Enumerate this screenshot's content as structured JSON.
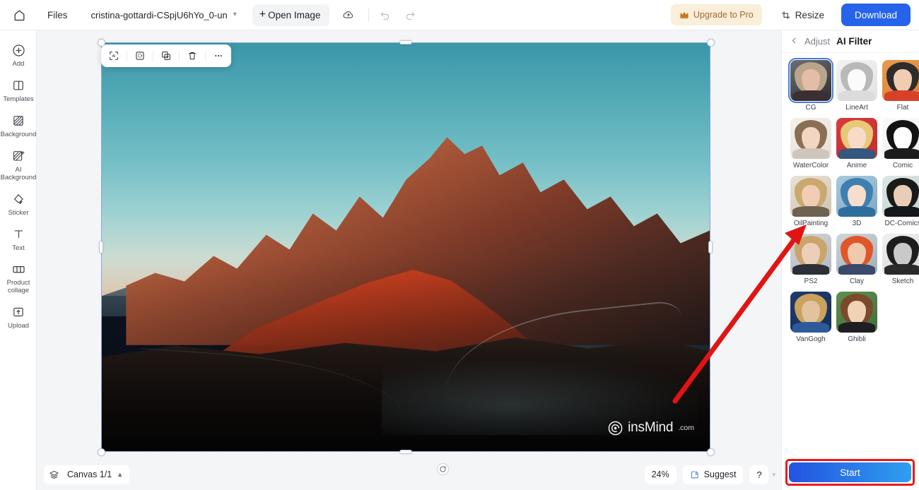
{
  "topbar": {
    "home_icon": "home-icon",
    "files_label": "Files",
    "filename": "cristina-gottardi-CSpjU6hYo_0-un",
    "filename_chevron": "chevron-down-icon",
    "open_image_label": "Open Image",
    "open_image_plus": "+",
    "cloud_icon": "cloud-sync-icon",
    "undo_icon": "undo-icon",
    "redo_icon": "redo-icon",
    "upgrade_label": "Upgrade to Pro",
    "upgrade_icon": "crown-icon",
    "upgrade_bg": "#fbeeda",
    "upgrade_fg": "#a06a2c",
    "resize_label": "Resize",
    "resize_icon": "resize-icon",
    "download_label": "Download",
    "download_bg": "#2563eb"
  },
  "sidebar": {
    "items": [
      {
        "label": "Add",
        "icon": "plus-circle-icon"
      },
      {
        "label": "Templates",
        "icon": "templates-icon"
      },
      {
        "label": "Background",
        "icon": "background-icon"
      },
      {
        "label": "AI Background",
        "icon": "ai-background-icon"
      },
      {
        "label": "Sticker",
        "icon": "sticker-icon"
      },
      {
        "label": "Text",
        "icon": "text-icon"
      },
      {
        "label": "Product collage",
        "icon": "product-collage-icon"
      },
      {
        "label": "Upload",
        "icon": "upload-icon"
      }
    ]
  },
  "canvas": {
    "object_toolbar": [
      {
        "name": "ai-crop-button",
        "icon": "ai-select-icon"
      },
      {
        "name": "cutout-button",
        "icon": "mask-icon"
      },
      {
        "name": "duplicate-button",
        "icon": "duplicate-icon"
      },
      {
        "name": "delete-button",
        "icon": "trash-icon"
      },
      {
        "name": "more-button",
        "icon": "ellipsis-icon"
      }
    ],
    "watermark_text": "insMind",
    "watermark_suffix": ".com",
    "watermark_icon": "insmind-logo-icon",
    "rotate_icon": "rotate-icon",
    "image_description": "Sunset mountain landscape photograph"
  },
  "bottombar": {
    "layers_icon": "layers-icon",
    "canvas_label": "Canvas 1/1",
    "canvas_chevron": "chevron-up-icon",
    "zoom_level": "24%",
    "suggest_label": "Suggest",
    "suggest_icon": "suggest-icon",
    "help_label": "?",
    "help_chevron": "chevron-down-icon"
  },
  "right_panel": {
    "back_icon": "chevron-left-icon",
    "adjust_tab": "Adjust",
    "title": "AI Filter",
    "selected_filter": "CG",
    "filters": [
      {
        "label": "CG",
        "selected": true,
        "c1": "#6d6f78",
        "c2": "#2b2d34",
        "hair": "#b9a58c",
        "face": "#e3bda8",
        "body": "#3a2f33"
      },
      {
        "label": "LineArt",
        "selected": false,
        "c1": "#f2f2f2",
        "c2": "#e2e2e2",
        "hair": "#b9b9b9",
        "face": "#fbfbfb",
        "body": "#dcdcdc"
      },
      {
        "label": "Flat",
        "selected": false,
        "c1": "#e89a4c",
        "c2": "#d8833a",
        "hair": "#2e2b2c",
        "face": "#f0cdb1",
        "body": "#d8402a"
      },
      {
        "label": "WaterColor",
        "selected": false,
        "c1": "#f4f1ec",
        "c2": "#e6e0d6",
        "hair": "#8a6f55",
        "face": "#f3d6c2",
        "body": "#cfc6bb"
      },
      {
        "label": "Anime",
        "selected": false,
        "c1": "#d93b3b",
        "c2": "#c02f2f",
        "hair": "#e8c978",
        "face": "#f6dcc6",
        "body": "#35567e"
      },
      {
        "label": "Comic",
        "selected": false,
        "c1": "#fafafa",
        "c2": "#ededed",
        "hair": "#131313",
        "face": "#ffffff",
        "body": "#1c1c1c"
      },
      {
        "label": "OilPainting",
        "selected": false,
        "c1": "#e9e2d6",
        "c2": "#cfc3b0",
        "hair": "#caa96f",
        "face": "#f0cdb4",
        "body": "#6f6250"
      },
      {
        "label": "3D",
        "selected": false,
        "c1": "#a8c8dc",
        "c2": "#7fa9c6",
        "hair": "#3f7fb0",
        "face": "#f7ddcc",
        "body": "#2f6f9e"
      },
      {
        "label": "DC-Comics",
        "selected": false,
        "c1": "#dce6e4",
        "c2": "#c3d2d0",
        "hair": "#1a1a1a",
        "face": "#e9cdb8",
        "body": "#14181c"
      },
      {
        "label": "PS2",
        "selected": false,
        "c1": "#d3d6da",
        "c2": "#b3b8bf",
        "hair": "#caa46a",
        "face": "#eccfb8",
        "body": "#2b3038"
      },
      {
        "label": "Clay",
        "selected": false,
        "c1": "#cfd6d8",
        "c2": "#9fb0b6",
        "hair": "#e0562a",
        "face": "#f0c9ad",
        "body": "#3a4a6b"
      },
      {
        "label": "Sketch",
        "selected": false,
        "c1": "#f0f0f0",
        "c2": "#d8d8d8",
        "hair": "#1d1d1d",
        "face": "#c9c9c9",
        "body": "#2a2a2a"
      },
      {
        "label": "VanGogh",
        "selected": false,
        "c1": "#1f3a6b",
        "c2": "#16305c",
        "hair": "#caa25c",
        "face": "#e2c39f",
        "body": "#2e5a9a"
      },
      {
        "label": "Ghibli",
        "selected": false,
        "c1": "#5f8f4e",
        "c2": "#3f6f3a",
        "hair": "#7a4a2a",
        "face": "#f2d2b4",
        "body": "#1d1d22"
      }
    ],
    "start_label": "Start",
    "start_gradient_from": "#2353e0",
    "start_gradient_to": "#2f9ff0",
    "highlight_color": "#ef1717"
  },
  "annotations": {
    "arrow_color": "#e11414",
    "arrow_from": "955,568",
    "arrow_to": "1120,322",
    "arrow_target": "OilPainting"
  }
}
